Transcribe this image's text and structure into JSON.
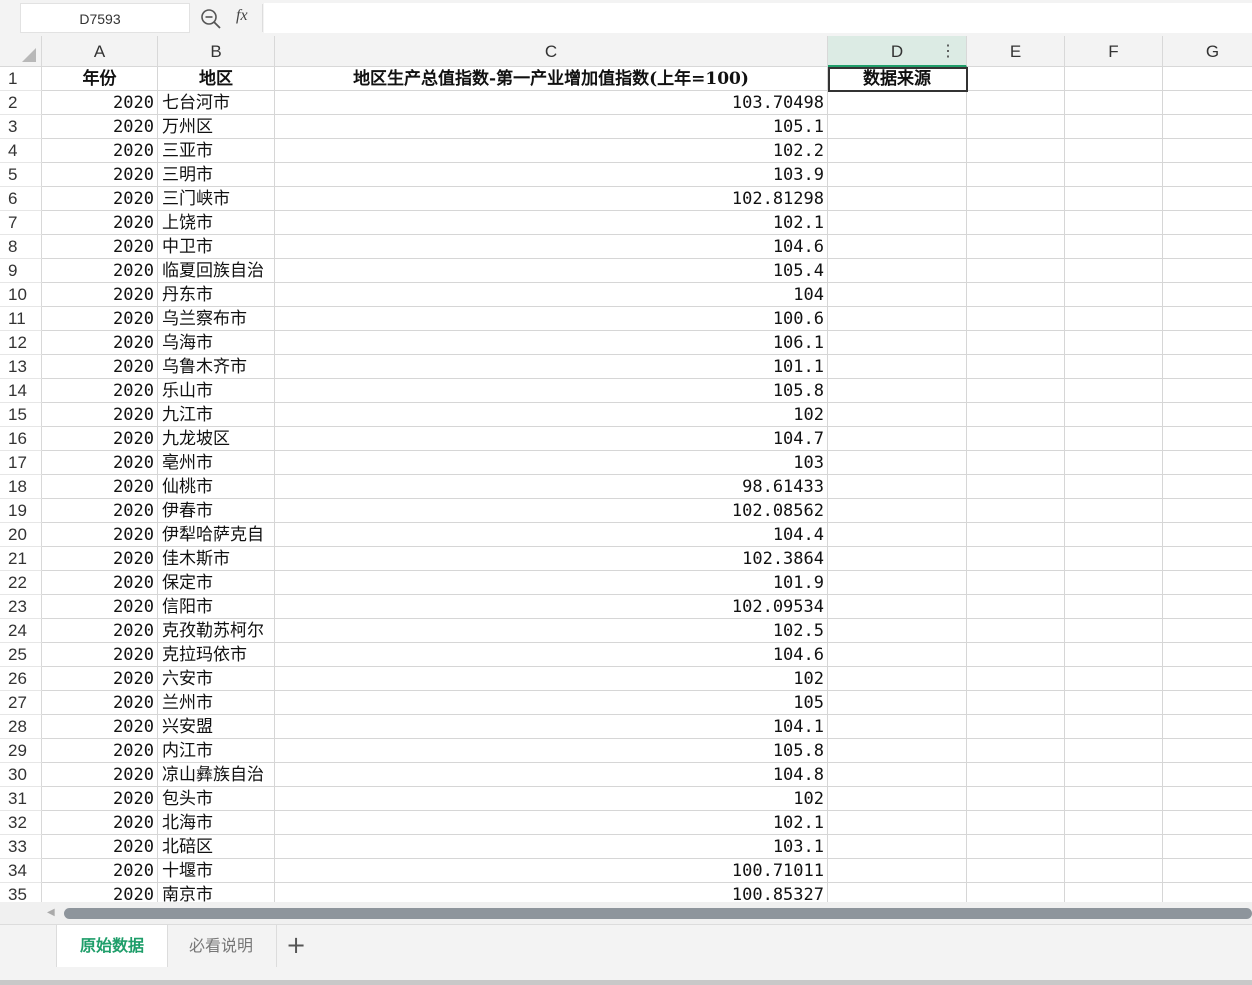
{
  "formula_bar": {
    "cell_ref": "D7593",
    "fx_label": "fx",
    "formula": ""
  },
  "columns": [
    "A",
    "B",
    "C",
    "D",
    "E",
    "F",
    "G"
  ],
  "header_row": {
    "row": "1",
    "A": "年份",
    "B": "地区",
    "C": "地区生产总值指数-第一产业增加值指数(上年=100)",
    "D": "数据来源"
  },
  "rows": [
    {
      "n": "2",
      "year": "2020",
      "region": "七台河市",
      "value": "103.70498"
    },
    {
      "n": "3",
      "year": "2020",
      "region": "万州区",
      "value": "105.1"
    },
    {
      "n": "4",
      "year": "2020",
      "region": "三亚市",
      "value": "102.2"
    },
    {
      "n": "5",
      "year": "2020",
      "region": "三明市",
      "value": "103.9"
    },
    {
      "n": "6",
      "year": "2020",
      "region": "三门峡市",
      "value": "102.81298"
    },
    {
      "n": "7",
      "year": "2020",
      "region": "上饶市",
      "value": "102.1"
    },
    {
      "n": "8",
      "year": "2020",
      "region": "中卫市",
      "value": "104.6"
    },
    {
      "n": "9",
      "year": "2020",
      "region": "临夏回族自治",
      "value": "105.4"
    },
    {
      "n": "10",
      "year": "2020",
      "region": "丹东市",
      "value": "104"
    },
    {
      "n": "11",
      "year": "2020",
      "region": "乌兰察布市",
      "value": "100.6"
    },
    {
      "n": "12",
      "year": "2020",
      "region": "乌海市",
      "value": "106.1"
    },
    {
      "n": "13",
      "year": "2020",
      "region": "乌鲁木齐市",
      "value": "101.1"
    },
    {
      "n": "14",
      "year": "2020",
      "region": "乐山市",
      "value": "105.8"
    },
    {
      "n": "15",
      "year": "2020",
      "region": "九江市",
      "value": "102"
    },
    {
      "n": "16",
      "year": "2020",
      "region": "九龙坡区",
      "value": "104.7"
    },
    {
      "n": "17",
      "year": "2020",
      "region": "亳州市",
      "value": "103"
    },
    {
      "n": "18",
      "year": "2020",
      "region": "仙桃市",
      "value": "98.61433"
    },
    {
      "n": "19",
      "year": "2020",
      "region": "伊春市",
      "value": "102.08562"
    },
    {
      "n": "20",
      "year": "2020",
      "region": "伊犁哈萨克自",
      "value": "104.4"
    },
    {
      "n": "21",
      "year": "2020",
      "region": "佳木斯市",
      "value": "102.3864"
    },
    {
      "n": "22",
      "year": "2020",
      "region": "保定市",
      "value": "101.9"
    },
    {
      "n": "23",
      "year": "2020",
      "region": "信阳市",
      "value": "102.09534"
    },
    {
      "n": "24",
      "year": "2020",
      "region": "克孜勒苏柯尔",
      "value": "102.5"
    },
    {
      "n": "25",
      "year": "2020",
      "region": "克拉玛依市",
      "value": "104.6"
    },
    {
      "n": "26",
      "year": "2020",
      "region": "六安市",
      "value": "102"
    },
    {
      "n": "27",
      "year": "2020",
      "region": "兰州市",
      "value": "105"
    },
    {
      "n": "28",
      "year": "2020",
      "region": "兴安盟",
      "value": "104.1"
    },
    {
      "n": "29",
      "year": "2020",
      "region": "内江市",
      "value": "105.8"
    },
    {
      "n": "30",
      "year": "2020",
      "region": "凉山彝族自治",
      "value": "104.8"
    },
    {
      "n": "31",
      "year": "2020",
      "region": "包头市",
      "value": "102"
    },
    {
      "n": "32",
      "year": "2020",
      "region": "北海市",
      "value": "102.1"
    },
    {
      "n": "33",
      "year": "2020",
      "region": "北碚区",
      "value": "103.1"
    },
    {
      "n": "34",
      "year": "2020",
      "region": "十堰市",
      "value": "100.71011"
    },
    {
      "n": "35",
      "year": "2020",
      "region": "南京市",
      "value": "100.85327"
    }
  ],
  "sheet_tabs": [
    {
      "label": "原始数据",
      "active": true
    },
    {
      "label": "必看说明",
      "active": false
    }
  ],
  "add_sheet_label": "+",
  "colors": {
    "accent": "#1f9e6a",
    "header_bg": "#f3f3f3",
    "selected_col_bg": "#dcebe4"
  }
}
